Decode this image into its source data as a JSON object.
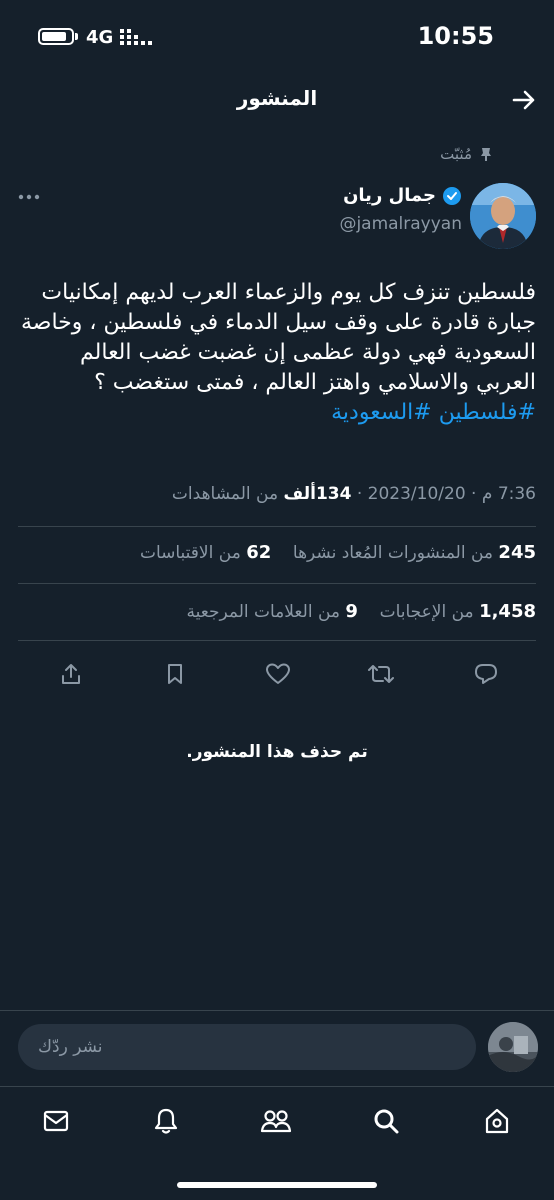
{
  "status_bar": {
    "time": "10:55",
    "network": "4G"
  },
  "header": {
    "title": "المنشور"
  },
  "pinned_label": "مُثبّت",
  "author": {
    "name": "جمال ريان",
    "handle": "@jamalrayyan"
  },
  "tweet": {
    "text": "فلسطين تنزف كل يوم والزعماء العرب لديهم إمكانيات جبارة قادرة على وقف سيل الدماء في فلسطين ، وخاصة السعودية فهي دولة عظمى إن غضبت غضب العالم العربي والاسلامي واهتز العالم ، فمتى ستغضب ؟",
    "hashtags": "#فلسطين #السعودية"
  },
  "meta": {
    "time": "7:36 م",
    "date": "2023/10/20",
    "views_count": "134ألف",
    "views_label": "من المشاهدات"
  },
  "stats": {
    "reposts_count": "245",
    "reposts_label": "من المنشورات المُعاد نشرها",
    "quotes_count": "62",
    "quotes_label": "من الاقتباسات",
    "likes_count": "1,458",
    "likes_label": "من الإعجابات",
    "bookmarks_count": "9",
    "bookmarks_label": "من العلامات المرجعية"
  },
  "actions": [
    "reply-icon",
    "repost-icon",
    "like-icon",
    "bookmark-icon",
    "share-icon"
  ],
  "deleted_notice": "تم حذف هذا المنشور.",
  "reply": {
    "placeholder": "نشر ردّك"
  },
  "bottom_nav": [
    "home-icon",
    "search-icon",
    "communities-icon",
    "notifications-icon",
    "messages-icon"
  ],
  "colors": {
    "background": "#15202b",
    "accent": "#1d9bf0",
    "secondary_text": "#8b98a5"
  }
}
